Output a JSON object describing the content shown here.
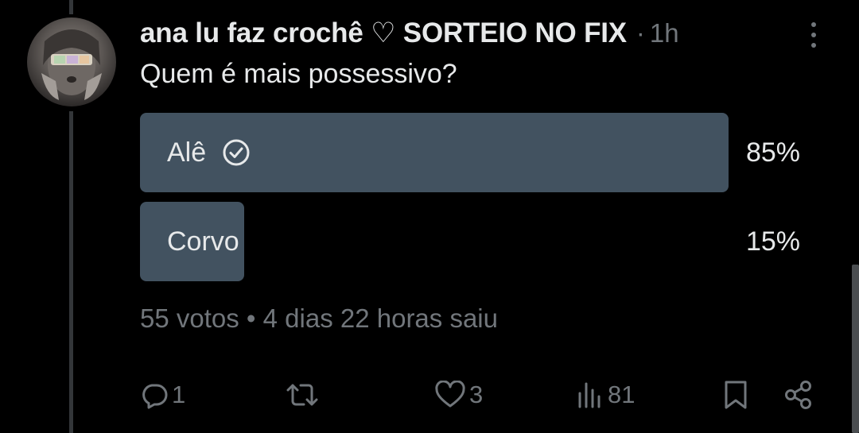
{
  "post": {
    "display_name": "ana lu faz crochê ♡ SORTEIO NO FIX",
    "separator": "·",
    "time": "1h",
    "question": "Quem é mais possessivo?"
  },
  "poll": {
    "options": [
      {
        "label": "Alê",
        "percent_label": "85%",
        "percent": 85,
        "winner": true
      },
      {
        "label": "Corvo",
        "percent_label": "15%",
        "percent": 15,
        "winner": false
      }
    ],
    "meta": "55 votos • 4 dias 22 horas saiu"
  },
  "actions": {
    "reply_count": "1",
    "retweet_count": "",
    "like_count": "3",
    "views_count": "81"
  },
  "icons": {
    "more": "more-vertical-icon",
    "check": "check-circle-icon",
    "reply": "reply-icon",
    "retweet": "retweet-icon",
    "like": "heart-icon",
    "views": "views-chart-icon",
    "bookmark": "bookmark-icon",
    "share": "share-icon"
  },
  "colors": {
    "background": "#000000",
    "text": "#e7e9ea",
    "muted": "#71767b",
    "poll_bar": "#425260"
  }
}
